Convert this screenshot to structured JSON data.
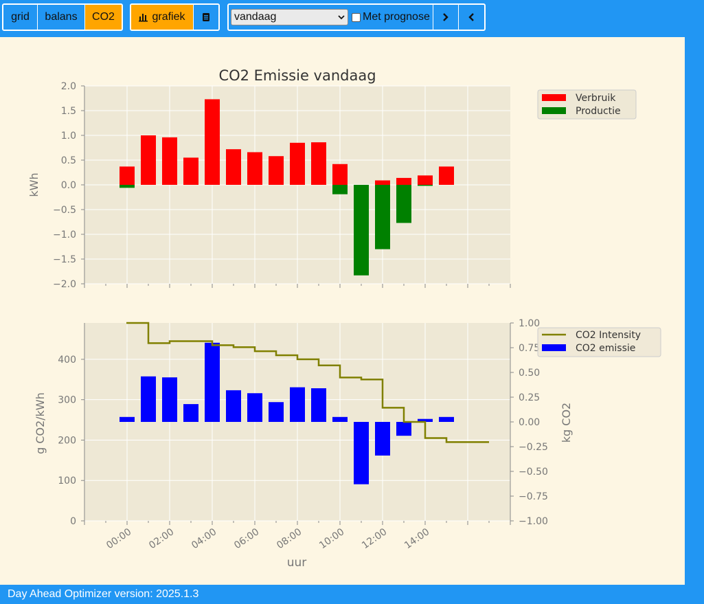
{
  "toolbar": {
    "view_tabs": [
      "grid",
      "balans",
      "CO2"
    ],
    "active_tab": "CO2",
    "mode_buttons": {
      "chart_label": "grafiek",
      "chart_icon": "bar-chart-icon",
      "table_icon": "table-icon"
    },
    "period_select": {
      "value": "vandaag"
    },
    "forecast_checkbox": {
      "label": "Met prognose",
      "checked": false
    },
    "nav": {
      "next_icon": "chevron-right-icon",
      "prev_icon": "chevron-left-icon"
    }
  },
  "footer": {
    "version_text": "Day Ahead Optimizer version: 2025.1.3"
  },
  "colors": {
    "toolbar_bg": "#2196f3",
    "active_button": "#ffa500",
    "page_bg": "#fdf6e3",
    "plot_bg": "#eee8d5"
  },
  "chart_data": [
    {
      "type": "bar",
      "title": "CO2 Emissie vandaag",
      "ylabel": "kWh",
      "ylim": [
        -2.0,
        2.0
      ],
      "yticks": [
        "2.0",
        "1.5",
        "1.0",
        "0.5",
        "0.0",
        "−0.5",
        "−1.0",
        "−1.5",
        "−2.0"
      ],
      "x_hours": [
        0,
        1,
        2,
        3,
        4,
        5,
        6,
        7,
        8,
        9,
        10,
        11,
        12,
        13,
        14,
        15
      ],
      "series": [
        {
          "name": "Verbruik",
          "color": "#ff0000",
          "values": [
            0.37,
            1.0,
            0.96,
            0.55,
            1.73,
            0.72,
            0.66,
            0.58,
            0.85,
            0.86,
            0.42,
            0.0,
            0.09,
            0.14,
            0.19,
            0.37
          ]
        },
        {
          "name": "Productie",
          "color": "#008000",
          "values": [
            -0.06,
            0.0,
            0.0,
            0.0,
            0.0,
            0.0,
            0.0,
            0.0,
            0.0,
            0.0,
            -0.19,
            -1.83,
            -1.3,
            -0.77,
            -0.02,
            0.0
          ]
        }
      ],
      "legend_position": "top-right"
    },
    {
      "type": "bar",
      "ylabel_left": "g CO2/kWh",
      "ylabel_right": "kg CO2",
      "xlabel": "uur",
      "ylim_left": [
        0,
        490
      ],
      "ylim_right": [
        -1.0,
        1.0
      ],
      "yticks_left": [
        "0",
        "100",
        "200",
        "300",
        "400"
      ],
      "yticks_right": [
        "1.00",
        "0.75",
        "0.50",
        "0.25",
        "0.00",
        "−0.25",
        "−0.50",
        "−0.75",
        "−1.00"
      ],
      "xtick_labels": [
        "00:00",
        "02:00",
        "04:00",
        "06:00",
        "08:00",
        "10:00",
        "12:00",
        "14:00"
      ],
      "x_hours": [
        0,
        1,
        2,
        3,
        4,
        5,
        6,
        7,
        8,
        9,
        10,
        11,
        12,
        13,
        14,
        15
      ],
      "series": [
        {
          "name": "CO2 Intensity",
          "type": "step",
          "color": "#808000",
          "values": [
            490,
            440,
            445,
            445,
            435,
            430,
            420,
            410,
            400,
            385,
            355,
            350,
            280,
            245,
            205,
            195,
            195
          ]
        },
        {
          "name": "CO2 emissie",
          "type": "bar",
          "color": "#0000ff",
          "values": [
            0.05,
            0.46,
            0.45,
            0.18,
            0.8,
            0.32,
            0.29,
            0.2,
            0.35,
            0.34,
            0.05,
            -0.63,
            -0.34,
            -0.14,
            0.03,
            0.05
          ]
        }
      ],
      "legend_position": "top-right"
    }
  ]
}
